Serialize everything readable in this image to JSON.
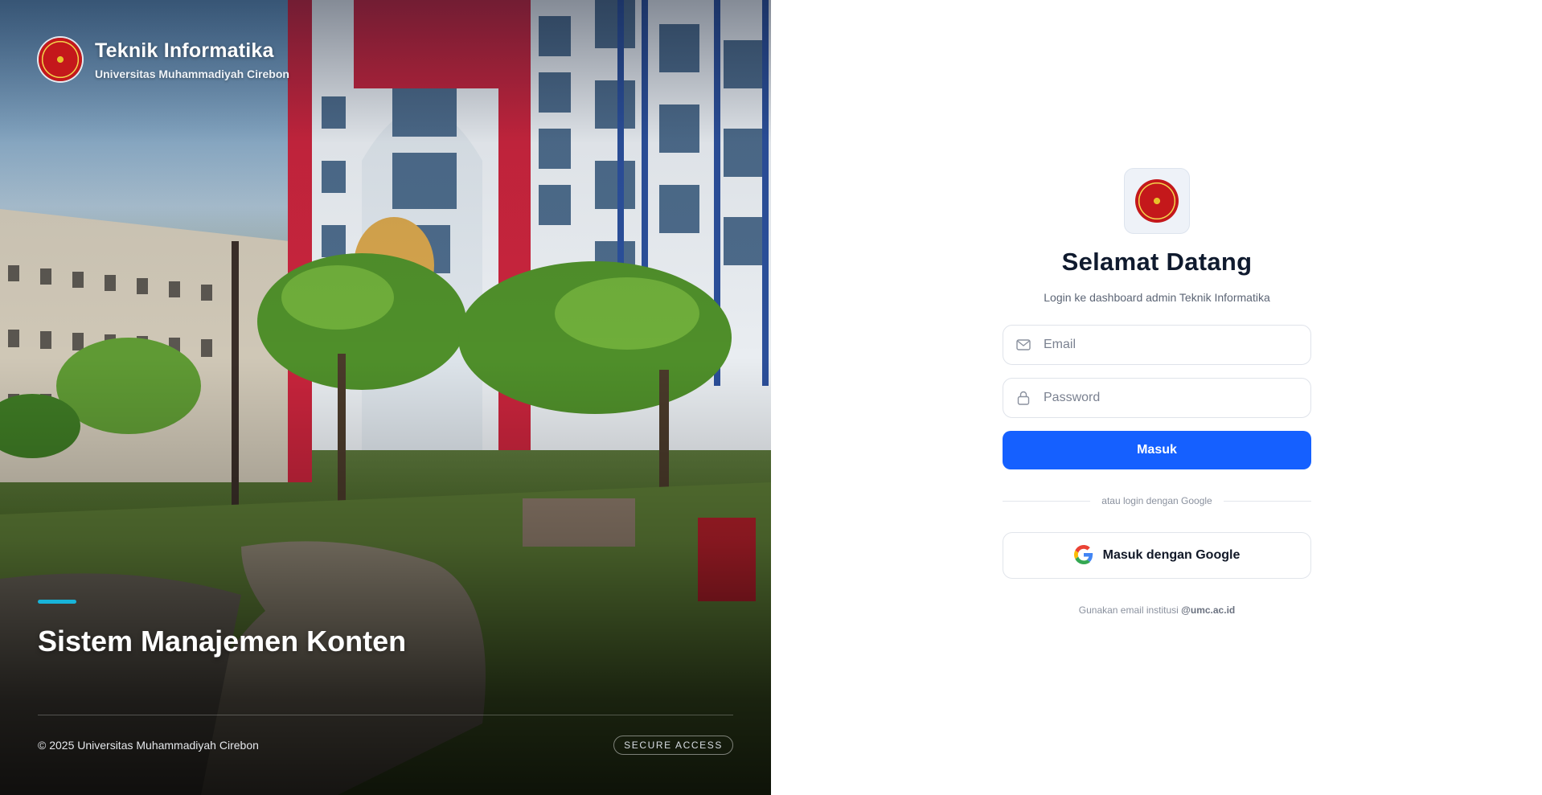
{
  "brand": {
    "title": "Teknik Informatika",
    "subtitle": "Universitas Muhammadiyah Cirebon",
    "logo_icon": "university-seal-icon"
  },
  "hero": {
    "heading": "Sistem Manajemen Konten",
    "copyright": "© 2025 Universitas Muhammadiyah Cirebon",
    "badge": "SECURE ACCESS",
    "accent_color": "#18b4d9",
    "photo": "campus-building-photo"
  },
  "login": {
    "title": "Selamat Datang",
    "subtitle": "Login ke dashboard admin Teknik Informatika",
    "email": {
      "placeholder": "Email",
      "value": "",
      "icon": "mail-icon"
    },
    "password": {
      "placeholder": "Password",
      "value": "",
      "icon": "lock-icon"
    },
    "submit_label": "Masuk",
    "divider_text": "atau login dengan Google",
    "google_label": "Masuk dengan Google",
    "google_icon": "google-icon",
    "hint_prefix": "Gunakan email institusi",
    "hint_domain": "@umc.ac.id"
  },
  "colors": {
    "primary": "#1560ff",
    "heading": "#0f1a2e",
    "muted": "#5c6575"
  }
}
